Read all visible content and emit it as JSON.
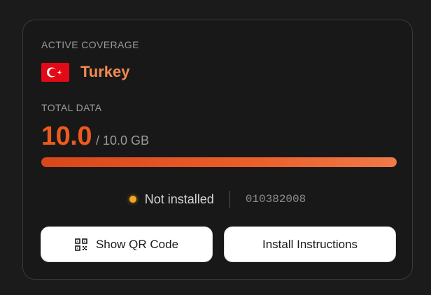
{
  "coverage": {
    "label": "ACTIVE COVERAGE",
    "country": "Turkey",
    "flag_icon": "turkey-flag",
    "country_color": "#f08a55"
  },
  "data": {
    "label": "TOTAL DATA",
    "used": "10.0",
    "total": "/ 10.0 GB",
    "progress_fraction": 1.0,
    "accent_color": "#ee5a1e"
  },
  "status": {
    "text": "Not installed",
    "dot_color": "#f5a623",
    "iccid": "010382008"
  },
  "actions": {
    "qr_label": "Show QR Code",
    "qr_icon": "qr-code-icon",
    "install_label": "Install Instructions"
  }
}
